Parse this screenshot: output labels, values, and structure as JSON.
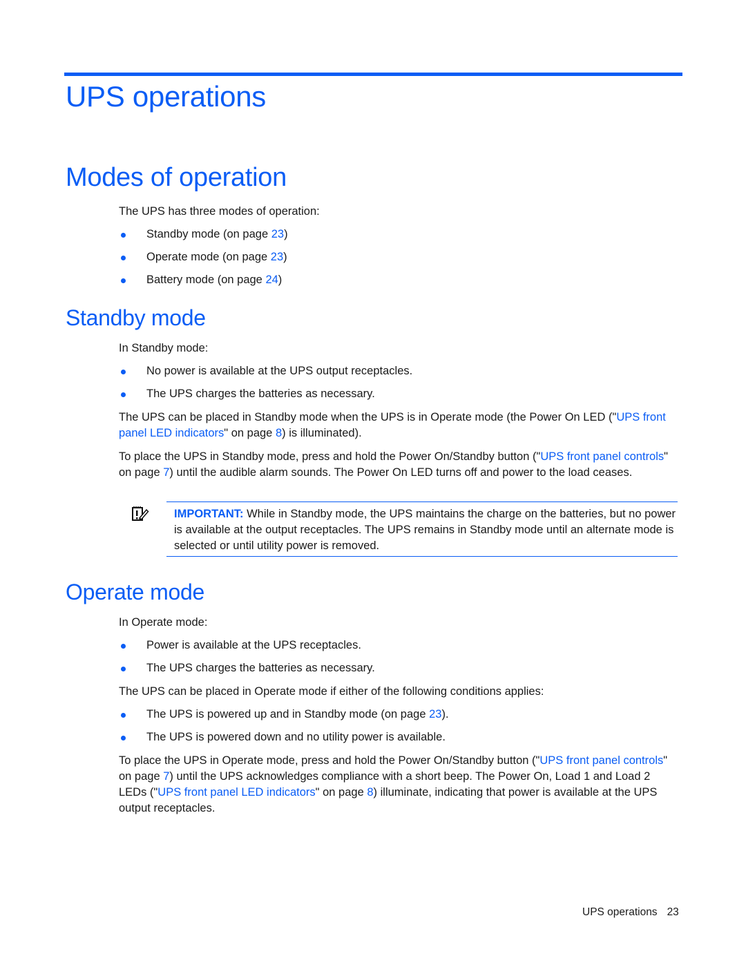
{
  "chapter_title": "UPS operations",
  "section": {
    "title": "Modes of operation",
    "intro": "The UPS has three modes of operation:",
    "modes": [
      {
        "text": "Standby mode (on page ",
        "page": "23",
        "suffix": ")"
      },
      {
        "text": "Operate mode (on page ",
        "page": "23",
        "suffix": ")"
      },
      {
        "text": "Battery mode (on page ",
        "page": "24",
        "suffix": ")"
      }
    ]
  },
  "standby": {
    "title": "Standby mode",
    "intro": "In Standby mode:",
    "bullets": [
      "No power is available at the UPS output receptacles.",
      "The UPS charges the batteries as necessary."
    ],
    "para1": {
      "before": "The UPS can be placed in Standby mode when the UPS is in Operate mode (the Power On LED (\"",
      "link": "UPS front panel LED indicators",
      "mid": "\" on page ",
      "page": "8",
      "after": ") is illuminated)."
    },
    "para2": {
      "before": "To place the UPS in Standby mode, press and hold the Power On/Standby button (\"",
      "link": "UPS front panel controls",
      "mid": "\" on page ",
      "page": "7",
      "after": ") until the audible alarm sounds. The Power On LED turns off and power to the load ceases."
    },
    "note": {
      "icon": "important-note-icon",
      "label": "IMPORTANT:",
      "text": " While in Standby mode, the UPS maintains the charge on the batteries, but no power is available at the output receptacles. The UPS remains in Standby mode until an alternate mode is selected or until utility power is removed."
    }
  },
  "operate": {
    "title": "Operate mode",
    "intro": "In Operate mode:",
    "bullets": [
      "Power is available at the UPS receptacles.",
      "The UPS charges the batteries as necessary."
    ],
    "conditions_intro": "The UPS can be placed in Operate mode if either of the following conditions applies:",
    "conditions": [
      {
        "text": "The UPS is powered up and in Standby mode (on page ",
        "page": "23",
        "suffix": ")."
      },
      {
        "text": "The UPS is powered down and no utility power is available.",
        "page": "",
        "suffix": ""
      }
    ],
    "para": {
      "before": "To place the UPS in Operate mode, press and hold the Power On/Standby button (\"",
      "link1": "UPS front panel controls",
      "mid1": "\" on page ",
      "page1": "7",
      "middle": ") until the UPS acknowledges compliance with a short beep. The Power On, Load 1 and Load 2 LEDs (\"",
      "link2": "UPS front panel LED indicators",
      "mid2": "\" on page ",
      "page2": "8",
      "after": ") illuminate, indicating that power is available at the UPS output receptacles."
    }
  },
  "footer": {
    "section": "UPS operations",
    "page": "23"
  },
  "colors": {
    "accent": "#0a5df5",
    "text": "#1a1a1a"
  }
}
